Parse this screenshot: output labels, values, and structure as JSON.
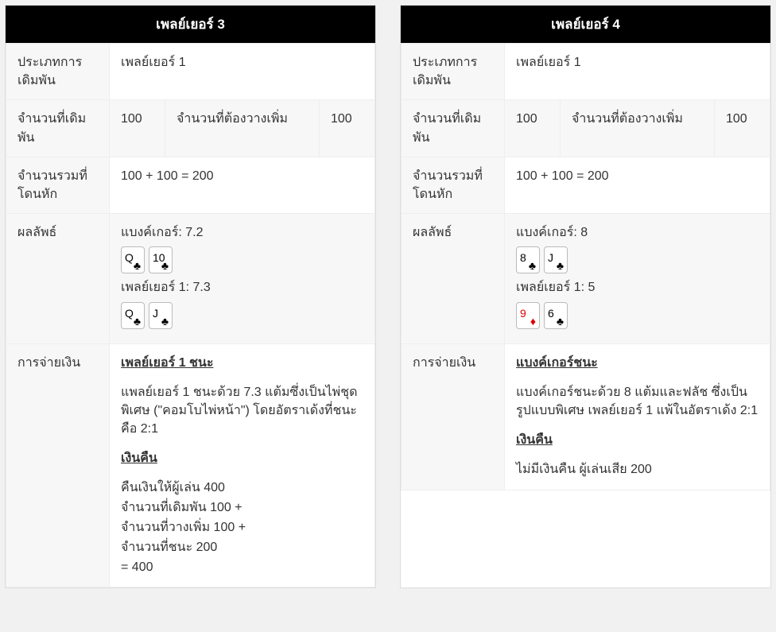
{
  "players": [
    {
      "title": "เพลย์เยอร์ 3",
      "bet_type_label": "ประเภทการเดิมพัน",
      "bet_type_value": "เพลย์เยอร์ 1",
      "bet_amount_label": "จำนวนที่เดิมพัน",
      "bet_amount_value": "100",
      "extra_label": "จำนวนที่ต้องวางเพิ่ม",
      "extra_value": "100",
      "total_label": "จำนวนรวมที่โดนหัก",
      "total_value": "100 + 100 = 200",
      "result_label": "ผลลัพธ์",
      "result": {
        "banker_text": "แบงค์เกอร์: 7.2",
        "banker_cards": [
          {
            "rank": "Q",
            "suit": "♣",
            "color": "black"
          },
          {
            "rank": "10",
            "suit": "♣",
            "color": "black"
          }
        ],
        "player_text": "เพลย์เยอร์ 1: 7.3",
        "player_cards": [
          {
            "rank": "Q",
            "suit": "♣",
            "color": "black"
          },
          {
            "rank": "J",
            "suit": "♣",
            "color": "black"
          }
        ]
      },
      "payout_label": "การจ่ายเงิน",
      "payout": {
        "headline": "เพลย์เยอร์ 1 ชนะ",
        "desc": "แพลย์เยอร์ 1 ชนะด้วย 7.3 แต้มซึ่งเป็นไพ่ชุดพิเศษ (\"คอมโบไพ่หน้า\") โดยอัตราเด้งที่ชนะคือ 2:1",
        "refund_title": "เงินคืน",
        "refund_lines": [
          "คืนเงินให้ผู้เล่น 400",
          "จำนวนที่เดิมพัน 100 +",
          "จำนวนที่วางเพิ่ม 100 +",
          "จำนวนที่ชนะ 200",
          "= 400"
        ]
      }
    },
    {
      "title": "เพลย์เยอร์ 4",
      "bet_type_label": "ประเภทการเดิมพัน",
      "bet_type_value": "เพลย์เยอร์ 1",
      "bet_amount_label": "จำนวนที่เดิมพัน",
      "bet_amount_value": "100",
      "extra_label": "จำนวนที่ต้องวางเพิ่ม",
      "extra_value": "100",
      "total_label": "จำนวนรวมที่โดนหัก",
      "total_value": "100 + 100 = 200",
      "result_label": "ผลลัพธ์",
      "result": {
        "banker_text": "แบงค์เกอร์: 8",
        "banker_cards": [
          {
            "rank": "8",
            "suit": "♣",
            "color": "black"
          },
          {
            "rank": "J",
            "suit": "♣",
            "color": "black"
          }
        ],
        "player_text": "เพลย์เยอร์ 1: 5",
        "player_cards": [
          {
            "rank": "9",
            "suit": "♦",
            "color": "red"
          },
          {
            "rank": "6",
            "suit": "♣",
            "color": "black"
          }
        ]
      },
      "payout_label": "การจ่ายเงิน",
      "payout": {
        "headline": "แบงค์เกอร์ชนะ",
        "desc": "แบงค์เกอร์ชนะด้วย 8 แต้มและฟลัช ซึ่งเป็นรูปแบบพิเศษ เพลย์เยอร์ 1 แพ้ในอัตราเด้ง 2:1",
        "refund_title": "เงินคืน",
        "refund_lines": [
          "ไม่มีเงินคืน ผู้เล่นเสีย 200"
        ]
      }
    }
  ]
}
